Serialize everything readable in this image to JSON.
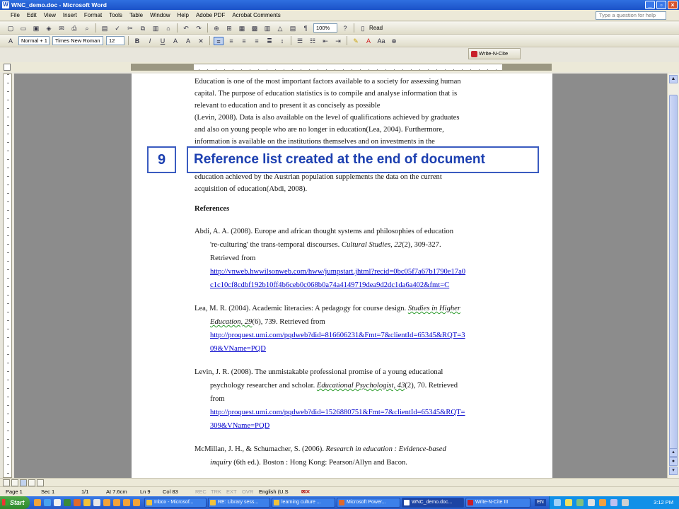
{
  "window": {
    "title": "WNC_demo.doc - Microsoft Word"
  },
  "menu": {
    "items": [
      "File",
      "Edit",
      "View",
      "Insert",
      "Format",
      "Tools",
      "Table",
      "Window",
      "Help",
      "Adobe PDF",
      "Acrobat Comments"
    ],
    "help_placeholder": "Type a question for help"
  },
  "toolbar": {
    "zoom": "100%",
    "read_label": "Read",
    "style": "Normal + 1",
    "font": "Times New Roman",
    "size": "12"
  },
  "wnc_toolbar": {
    "label": "Write-N-Cite"
  },
  "document": {
    "para": [
      "Education is one of the most important factors available to a society for assessing human",
      "capital. The purpose of education statistics is to compile and analyse information that is",
      "relevant to education and to present it as concisely as possible",
      "(Levin, 2008). Data is also available on the level of qualifications achieved by graduates",
      "and also on young people who are no longer in education(Lea, 2004). Furthermore,",
      "information is available on the institutions themselves and on investments in the",
      "education achieved by the Austrian population supplements the data on the current",
      "acquisition of education(Abdi, 2008)."
    ],
    "references_heading": "References",
    "refs": {
      "abdi": {
        "l1_author": "Abdi, A. A. (2008). Europe and african thought systems and philosophies of education",
        "l2_a": "'re-culturing' the trans-temporal discourses. ",
        "l2_journal": "Cultural Studies, 22",
        "l2_b": "(2), 309-327.",
        "l3": "Retrieved from",
        "url1": "http://vnweb.hwwilsonweb.com/hww/jumpstart.jhtml?recid=0bc05f7a67b1790e17a0",
        "url2": "c1c10cf8cdbf192b10ff4b6ceb0c068b0a74a4149719dea9d2dc1da6a402&fmt=C"
      },
      "lea": {
        "l1_a": "Lea, M. R. (2004). Academic literacies: A pedagogy for course design. ",
        "l1_journal": "Studies in Higher",
        "l2_journal": "Education, 29",
        "l2_b": "(6), 739. Retrieved from",
        "url1": "http://proquest.umi.com/pqdweb?did=816606231&Fmt=7&clientId=65345&RQT=3",
        "url2": "09&VName=PQD"
      },
      "levin": {
        "l1": "Levin, J. R. (2008). The unmistakable professional promise of a young educational",
        "l2_a": "psychology researcher and scholar. ",
        "l2_journal": "Educational Psychologist, 43",
        "l2_b": "(2), 70. Retrieved",
        "l3": "from",
        "url1": "http://proquest.umi.com/pqdweb?did=1526880751&Fmt=7&clientId=65345&RQT=",
        "url2": "309&VName=PQD"
      },
      "mcmillan": {
        "l1_a": "McMillan, J. H., & Schumacher, S. (2006). ",
        "l1_title": "Research in education : Evidence-based",
        "l2_title": "inquiry",
        "l2_b": " (6th ed.). Boston : Hong Kong: Pearson/Allyn and Bacon."
      }
    }
  },
  "callout": {
    "number": "9",
    "text": "Reference list created at the end of document"
  },
  "status": {
    "page": "Page 1",
    "sec": "Sec 1",
    "pages": "1/1",
    "at": "At 7.6cm",
    "ln": "Ln 9",
    "col": "Col 83",
    "rec": "REC",
    "trk": "TRK",
    "ext": "EXT",
    "ovr": "OVR",
    "lang": "English (U.S"
  },
  "taskbar": {
    "start": "Start",
    "tasks": [
      "Inbox - Microsof...",
      "RE: Library sess...",
      "learning culture ...",
      "Microsoft Power...",
      "WNC_demo.doc...",
      "Write-N-Cite III"
    ],
    "lang": "EN",
    "clock": "3:12 PM"
  }
}
